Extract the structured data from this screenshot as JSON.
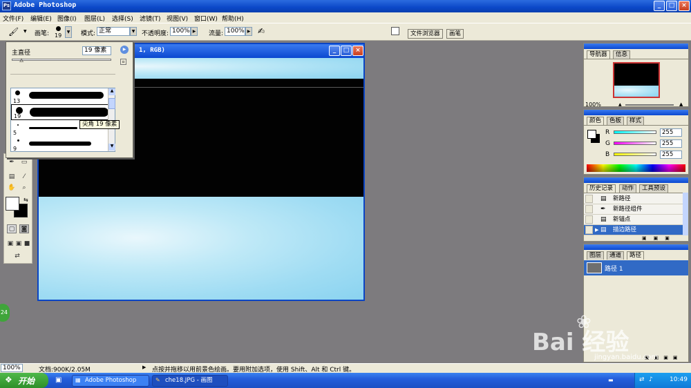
{
  "window": {
    "app_icon": "Ps",
    "title": "Adobe Photoshop",
    "minimize": "_",
    "maximize": "□",
    "close": "×"
  },
  "menu": [
    "文件(F)",
    "编辑(E)",
    "图像(I)",
    "图层(L)",
    "选择(S)",
    "滤镜(T)",
    "视图(V)",
    "窗口(W)",
    "帮助(H)"
  ],
  "options": {
    "brush_label": "画笔:",
    "brush_size": "19",
    "mode_label": "模式:",
    "mode_value": "正常",
    "opacity_label": "不透明度:",
    "opacity_value": "100%",
    "flow_label": "流量:",
    "flow_value": "100%",
    "dock_tabs": [
      "文件浏览器",
      "画笔"
    ]
  },
  "brush_popup": {
    "diameter_label": "主直径",
    "diameter_value": "19 像素",
    "diameter_level": 0.1,
    "tooltip": "尖角 19 像素",
    "presets": [
      {
        "size": "13"
      },
      {
        "size": "19"
      },
      {
        "size": "5"
      },
      {
        "size": "9"
      }
    ]
  },
  "document": {
    "title_fragment": "1, RGB)"
  },
  "navigator": {
    "tabs": [
      "导航器",
      "信息"
    ],
    "zoom": "100%"
  },
  "color_panel": {
    "tabs": [
      "颜色",
      "色板",
      "样式"
    ],
    "channels": [
      {
        "label": "R",
        "value": "255"
      },
      {
        "label": "G",
        "value": "255"
      },
      {
        "label": "B",
        "value": "255"
      }
    ]
  },
  "history_panel": {
    "tabs": [
      "历史记录",
      "动作",
      "工具预设"
    ],
    "items": [
      {
        "label": "新路径",
        "icon": "document-icon"
      },
      {
        "label": "新路径组件",
        "icon": "pen-icon"
      },
      {
        "label": "新锚点",
        "icon": "document-icon"
      },
      {
        "label": "描边路径",
        "icon": "document-icon",
        "selected": true
      }
    ]
  },
  "layers_panel": {
    "tabs": [
      "图层",
      "通道",
      "路径"
    ],
    "paths": [
      "路径 1"
    ]
  },
  "statusbar": {
    "zoom": "100%",
    "doc_info": "文档:900K/2.05M",
    "hint": "点按并拖移以用前景色绘画。要用附加选项，使用 Shift、Alt 和 Ctrl 键。"
  },
  "taskbar": {
    "start": "开始",
    "tasks": [
      "Adobe Photoshop",
      "che18.JPG - 画图"
    ],
    "clock": "10:49"
  },
  "watermark": {
    "text": "Bai 经验",
    "url": "jingyan.baidu.com"
  },
  "side_badge": "24",
  "colors": {
    "accent": "#0a44c4",
    "selection": "#316ac5",
    "sky": "#a6dff4",
    "workspace": "#7d7b7e"
  }
}
